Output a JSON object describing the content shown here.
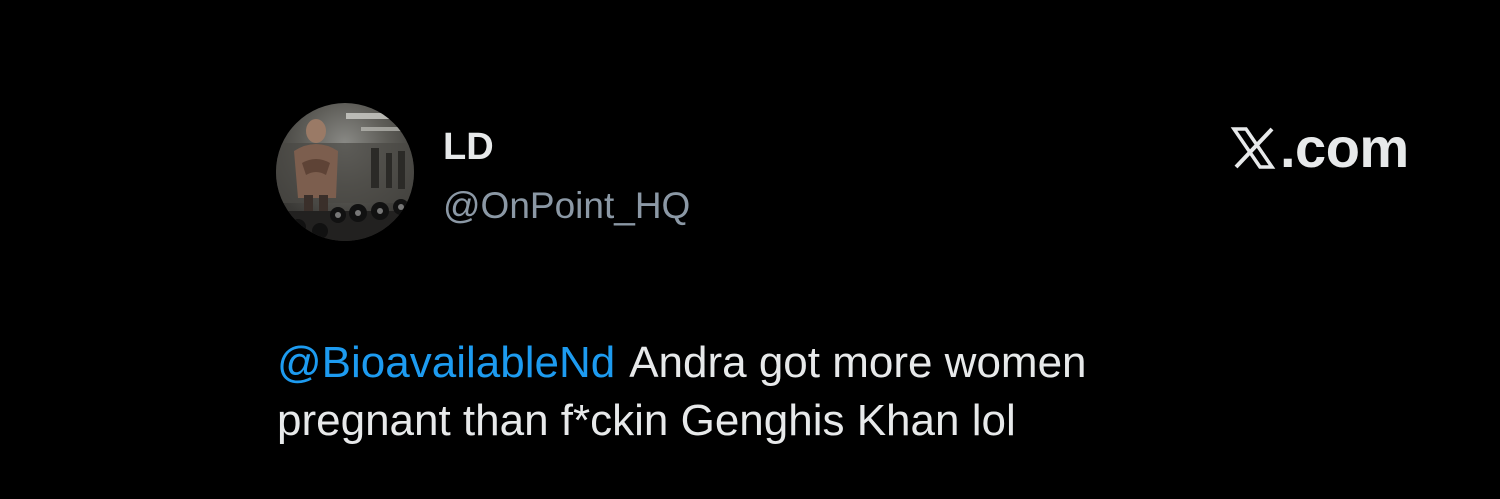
{
  "author": {
    "display_name": "LD",
    "handle": "@OnPoint_HQ",
    "avatar_icon": "avatar-photo-icon"
  },
  "brand": {
    "logo_icon": "x-logo-icon",
    "text": ".com"
  },
  "tweet": {
    "mention": "@BioavailableNd",
    "line1": "Andra got more women",
    "line2": "pregnant than f*ckin Genghis Khan lol"
  },
  "colors": {
    "background": "#000000",
    "text_primary": "#e7e9ea",
    "text_secondary": "#8b98a5",
    "accent": "#1d9bf0"
  }
}
